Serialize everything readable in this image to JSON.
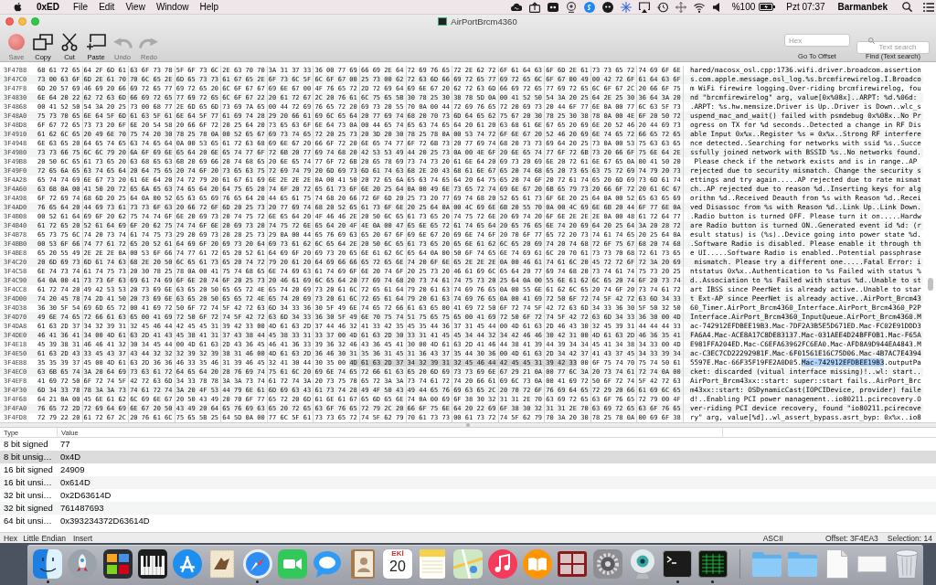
{
  "menu_bar": {
    "app_name": "0xED",
    "menus": [
      "File",
      "Edit",
      "View",
      "Window",
      "Help"
    ],
    "battery_text": "%100",
    "clock": "Pzt 07:37",
    "user": "Barmanbek"
  },
  "window": {
    "title": "AirPortBrcm4360"
  },
  "toolbar": {
    "tools": [
      {
        "kind": "save",
        "label": "Save",
        "disabled": true
      },
      {
        "kind": "copy",
        "label": "Copy",
        "disabled": false
      },
      {
        "kind": "cut",
        "label": "Cut",
        "disabled": false
      },
      {
        "kind": "paste",
        "label": "Paste",
        "disabled": false
      },
      {
        "kind": "undo",
        "label": "Undo",
        "disabled": true
      },
      {
        "kind": "redo",
        "label": "Redo",
        "disabled": true
      }
    ],
    "go_to_offset": {
      "placeholder": "Hex",
      "label": "Go To Offset"
    },
    "text_search": {
      "placeholder": "Text search",
      "label": "Find (Text search)"
    }
  },
  "hex_view": {
    "rows": [
      {
        "offset": "3F4788",
        "hex": [
          {
            "text": "68 61 72 65 64 2F 6D 61 63 6F 73 78 5F 6F 73 6C 2E 63 70 70 3A 31 37 33 36 00 77 69 66 69 2E 64 72 69 76 65 72 2E 62 72 6F 61 64 63 6F 6D 2E 61 73 73 65 72 74 69 6F 6E",
            "selected": false
          }
        ],
        "ascii": [
          {
            "text": "hared/macosx_osl.cpp:1736.wifi.driver.broadcom.assertion",
            "selected": false
          }
        ]
      },
      {
        "offset": "3F47C0",
        "hex": [
          {
            "text": "73 00 63 6F 6D 2E 61 70 70 6C 65 2E 6D 65 73 73 61 67 65 2E 6F 73 6C 5F 6C 6F 67 00 25 73 00 62 72 63 6D 66 69 72 65 77 69 72 65 6C 6F 67 00 49 00 42 72 6F 61 64 63 6F",
            "selected": false
          }
        ],
        "ascii": [
          {
            "text": "s.com.apple.message.osl_log.%s.brcmfirewirelog.I.Broadco",
            "selected": false
          }
        ]
      },
      {
        "offset": "3F47F8",
        "hex": [
          {
            "text": "6D 20 57 69 46 69 20 66 69 72 65 77 69 72 65 20 6C 6F 67 67 69 6E 67 00 4F 76 65 72 2D 72 69 64 69 6E 67 20 62 72 63 6D 66 69 72 65 77 69 72 65 6C 6F 67 2C 20 66 6F 75",
            "selected": false
          }
        ],
        "ascii": [
          {
            "text": "m WiFi firewire logging.Over-riding brcmfirewirelog, fou",
            "selected": false
          }
        ]
      },
      {
        "offset": "3F4830",
        "hex": [
          {
            "text": "6E 64 20 22 62 72 63 6D 66 69 72 65 77 69 72 65 6C 6F 67 22 20 61 72 67 2C 20 76 61 6C 75 65 5B 30 78 25 30 38 78 5D 0A 00 41 52 50 54 3A 20 25 64 2E 25 30 36 64 3A 20",
            "selected": false
          }
        ],
        "ascii": [
          {
            "text": "nd \"brcmfirewirelog\" arg, value[0x%08x]..ARPT: %d.%06d: ",
            "selected": false
          }
        ]
      },
      {
        "offset": "3F4868",
        "hex": [
          {
            "text": "00 41 52 50 54 3A 20 25 73 00 68 77 2E 6D 65 6D 73 69 7A 65 00 44 72 69 76 65 72 20 69 73 20 55 70 0A 00 44 72 69 76 65 72 20 69 73 20 44 6F 77 6E 0A 00 77 6C 63 5F 73",
            "selected": false
          }
        ],
        "ascii": [
          {
            "text": ".ARPT: %s.hw.memsize.Driver is Up..Driver is Down..wlc_s",
            "selected": false
          }
        ]
      },
      {
        "offset": "3F48A0",
        "hex": [
          {
            "text": "75 73 70 65 6E 64 5F 6D 61 63 5F 61 6E 64 5F 77 61 69 74 28 29 20 66 61 69 6C 65 64 20 77 69 74 68 20 70 73 6D 64 65 62 75 67 20 30 78 25 30 38 78 0A 00 4E 6F 20 50 72",
            "selected": false
          }
        ],
        "ascii": [
          {
            "text": "uspend_mac_and_wait() failed with psmdebug 0x%08x..No Pr",
            "selected": false
          }
        ]
      },
      {
        "offset": "3F48D8",
        "hex": [
          {
            "text": "6F 67 72 65 73 73 20 6F 6E 20 54 58 20 66 6F 72 20 25 64 20 73 65 63 6F 6E 64 73 0A 00 44 65 74 65 63 74 65 64 20 61 20 63 68 61 6E 67 65 20 69 6E 20 52 46 20 44 69 73",
            "selected": false
          }
        ],
        "ascii": [
          {
            "text": "ogress on TX for %d seconds..Detected a change in RF Dis",
            "selected": false
          }
        ]
      },
      {
        "offset": "3F4910",
        "hex": [
          {
            "text": "61 62 6C 65 20 49 6E 70 75 74 20 30 78 25 78 0A 00 52 65 67 69 73 74 65 72 20 25 73 20 3D 20 30 78 25 78 0A 00 53 74 72 6F 6E 67 20 52 46 20 69 6E 74 65 72 66 65 72 65",
            "selected": false
          }
        ],
        "ascii": [
          {
            "text": "able Input 0x%x..Register %s = 0x%x..Strong RF interfere",
            "selected": false
          }
        ]
      },
      {
        "offset": "3F4948",
        "hex": [
          {
            "text": "6E 63 65 20 64 65 74 65 63 74 65 64 0A 00 53 65 61 72 63 68 69 6E 67 20 66 6F 72 20 6E 65 74 77 6F 72 6B 73 20 77 69 74 68 20 73 73 69 64 20 25 73 0A 00 53 75 63 63 65",
            "selected": false
          }
        ],
        "ascii": [
          {
            "text": "nce detected..Searching for networks with ssid %s..Succe",
            "selected": false
          }
        ]
      },
      {
        "offset": "3F4980",
        "hex": [
          {
            "text": "73 73 66 75 6C 6C 79 20 6A 6F 69 6E 65 64 20 6E 65 74 77 6F 72 6B 20 77 69 74 68 20 42 53 53 49 44 20 25 73 0A 00 4E 6F 20 6E 65 74 77 6F 72 6B 73 20 66 6F 75 6E 64 2E",
            "selected": false
          }
        ],
        "ascii": [
          {
            "text": "ssfully joined network with BSSID %s..No networks found.",
            "selected": false
          }
        ]
      },
      {
        "offset": "3F49B8",
        "hex": [
          {
            "text": "20 50 6C 65 61 73 65 20 63 68 65 63 6B 20 69 66 20 74 68 65 20 6E 65 74 77 6F 72 6B 20 65 78 69 73 74 73 20 61 6E 64 20 69 73 20 69 6E 20 72 61 6E 67 65 0A 00 41 50 20",
            "selected": false
          }
        ],
        "ascii": [
          {
            "text": " Please check if the network exists and is in range..AP ",
            "selected": false
          }
        ]
      },
      {
        "offset": "3F49F0",
        "hex": [
          {
            "text": "72 65 6A 65 63 74 65 64 20 64 75 65 20 74 6F 20 73 65 63 75 72 69 74 79 20 6D 69 73 6D 61 74 63 68 2E 20 43 68 61 6E 67 65 20 74 68 65 20 73 65 63 75 72 69 74 79 20 73",
            "selected": false
          }
        ],
        "ascii": [
          {
            "text": "rejected due to security mismatch. Change the security s",
            "selected": false
          }
        ]
      },
      {
        "offset": "3F4A28",
        "hex": [
          {
            "text": "65 74 74 69 6E 67 73 20 61 6E 64 20 74 72 79 20 61 67 61 69 6E 2E 2E 2E 0A 00 41 50 20 72 65 6A 65 63 74 65 64 20 64 75 65 20 74 6F 20 72 61 74 65 20 6D 69 73 6D 61 74",
            "selected": false
          }
        ],
        "ascii": [
          {
            "text": "ettings and try again.....AP rejected due to rate mismat",
            "selected": false
          }
        ]
      },
      {
        "offset": "3F4A60",
        "hex": [
          {
            "text": "63 68 0A 00 41 50 20 72 65 6A 65 63 74 65 64 20 64 75 65 20 74 6F 20 72 65 61 73 6F 6E 20 25 64 0A 00 49 6E 73 65 72 74 69 6E 67 20 6B 65 79 73 20 66 6F 72 20 61 6C 67",
            "selected": false
          }
        ],
        "ascii": [
          {
            "text": "ch..AP rejected due to reason %d..Inserting keys for alg",
            "selected": false
          }
        ]
      },
      {
        "offset": "3F4A98",
        "hex": [
          {
            "text": "6F 72 69 74 68 6D 20 25 64 0A 00 52 65 63 65 69 76 65 64 20 44 65 61 75 74 68 20 66 72 6F 6D 20 25 73 20 77 69 74 68 20 52 65 61 73 6F 6E 20 25 64 0A 00 52 65 63 65 69",
            "selected": false
          }
        ],
        "ascii": [
          {
            "text": "orithm %d..Received Deauth from %s with Reason %d..Recei",
            "selected": false
          }
        ]
      },
      {
        "offset": "3F4AD0",
        "hex": [
          {
            "text": "76 65 64 20 44 69 73 61 73 73 6F 63 20 66 72 6F 6D 20 25 73 20 77 69 74 68 20 52 65 61 73 6F 6E 20 25 64 0A 00 4C 69 6E 6B 20 55 70 0A 00 4C 69 6E 6B 20 44 6F 77 6E 0A",
            "selected": false
          }
        ],
        "ascii": [
          {
            "text": "ved Disassoc from %s with Reason %d..Link Up..Link Down.",
            "selected": false
          }
        ]
      },
      {
        "offset": "3F4B08",
        "hex": [
          {
            "text": "00 52 61 64 69 6F 20 62 75 74 74 6F 6E 20 69 73 20 74 75 72 6E 65 64 20 4F 46 46 2E 20 50 6C 65 61 73 65 20 74 75 72 6E 20 69 74 20 6F 6E 2E 2E 2E 0A 00 48 61 72 64 77",
            "selected": false
          }
        ],
        "ascii": [
          {
            "text": ".Radio button is turned OFF. Please turn it on.....Hardw",
            "selected": false
          }
        ]
      },
      {
        "offset": "3F4B40",
        "hex": [
          {
            "text": "61 72 65 20 52 61 64 69 6F 20 62 75 74 74 6F 6E 20 69 73 20 74 75 72 6E 65 64 20 4F 4E 0A 00 47 65 6E 65 72 61 74 65 64 20 65 76 65 6E 74 20 69 64 20 25 64 3A 20 28 72",
            "selected": false
          }
        ],
        "ascii": [
          {
            "text": "are Radio button is turned ON..Generated event id %d: (r",
            "selected": false
          }
        ]
      },
      {
        "offset": "3F4B78",
        "hex": [
          {
            "text": "65 73 75 6C 74 20 73 74 61 74 75 73 29 20 69 73 20 28 25 73 29 0A 00 44 65 76 69 63 65 20 67 6F 69 6E 67 20 69 6E 74 6F 20 70 6F 77 65 72 20 73 74 61 74 65 20 25 64 0A",
            "selected": false
          }
        ],
        "ascii": [
          {
            "text": "esult status) is (%s)..Device going into power state %d.",
            "selected": false
          }
        ]
      },
      {
        "offset": "3F4BB0",
        "hex": [
          {
            "text": "00 53 6F 66 74 77 61 72 65 20 52 61 64 69 6F 20 69 73 20 64 69 73 61 62 6C 65 64 2E 20 50 6C 65 61 73 65 20 65 6E 61 62 6C 65 20 69 74 20 74 68 72 6F 75 67 68 20 74 68",
            "selected": false
          }
        ],
        "ascii": [
          {
            "text": ".Software Radio is disabled. Please enable it through th",
            "selected": false
          }
        ]
      },
      {
        "offset": "3F4BE8",
        "hex": [
          {
            "text": "65 20 55 49 2E 2E 2E 0A 00 53 6F 66 74 77 61 72 65 20 52 61 64 69 6F 20 69 73 20 65 6E 61 62 6C 65 64 0A 00 50 6F 74 65 6E 74 69 61 6C 20 70 61 73 73 70 68 72 61 73 65",
            "selected": false
          }
        ],
        "ascii": [
          {
            "text": "e UI.....Software Radio is enabled..Potential passphrase",
            "selected": false
          }
        ]
      },
      {
        "offset": "3F4C20",
        "hex": [
          {
            "text": "20 6D 69 73 6D 61 74 63 68 2E 20 50 6C 65 61 73 65 20 74 72 79 20 61 20 64 69 66 66 65 72 65 6E 74 20 6F 6E 65 2E 2E 2E 0A 00 46 61 74 61 6C 20 45 72 72 6F 72 3A 20 69",
            "selected": false
          }
        ],
        "ascii": [
          {
            "text": " mismatch. Please try a different one.....Fatal Error: i",
            "selected": false
          }
        ]
      },
      {
        "offset": "3F4C58",
        "hex": [
          {
            "text": "6E 74 73 74 61 74 75 73 20 30 78 25 78 0A 00 41 75 74 68 65 6E 74 69 63 61 74 69 6F 6E 20 74 6F 20 25 73 20 46 61 69 6C 65 64 20 77 69 74 68 20 73 74 61 74 75 73 20 25",
            "selected": false
          }
        ],
        "ascii": [
          {
            "text": "ntstatus 0x%x..Authentication to %s Failed with status %",
            "selected": false
          }
        ]
      },
      {
        "offset": "3F4C90",
        "hex": [
          {
            "text": "64 0A 00 41 73 73 6F 63 69 61 74 69 6F 6E 20 74 6F 20 25 73 20 46 61 69 6C 65 64 20 77 69 74 68 20 73 74 61 74 75 73 20 25 64 0A 00 55 6E 61 62 6C 65 20 74 6F 20 73 74",
            "selected": false
          }
        ],
        "ascii": [
          {
            "text": "d..Association to %s Failed with status %d..Unable to st",
            "selected": false
          }
        ]
      },
      {
        "offset": "3F4CC8",
        "hex": [
          {
            "text": "61 72 74 20 49 42 53 53 20 73 69 6E 63 65 20 50 65 65 72 4E 65 74 20 69 73 20 61 6C 72 65 61 64 79 20 61 63 74 69 76 65 0A 00 55 6E 61 62 6C 65 20 74 6F 20 73 74 61 72",
            "selected": false
          }
        ],
        "ascii": [
          {
            "text": "art IBSS since PeerNet is already active..Unable to star",
            "selected": false
          }
        ]
      },
      {
        "offset": "3F4D00",
        "hex": [
          {
            "text": "74 20 45 78 74 2D 41 50 20 73 69 6E 63 65 20 50 65 65 72 4E 65 74 20 69 73 20 61 6C 72 65 61 64 79 20 61 63 74 69 76 65 0A 00 41 69 72 50 6F 72 74 5F 42 72 63 6D 34 33",
            "selected": false
          }
        ],
        "ascii": [
          {
            "text": "t Ext-AP since PeerNet is already active..AirPort_Brcm43",
            "selected": false
          }
        ]
      },
      {
        "offset": "3F4D38",
        "hex": [
          {
            "text": "36 30 5F 54 69 6D 65 72 00 41 69 72 50 6F 72 74 5F 42 72 63 6D 34 33 36 30 5F 49 6E 74 65 72 66 61 63 65 00 41 69 72 50 6F 72 74 5F 42 72 63 6D 34 33 36 30 5F 50 32 50",
            "selected": false
          }
        ],
        "ascii": [
          {
            "text": "60_Timer.AirPort_Brcm4360_Interface.AirPort_Brcm4360_P2P",
            "selected": false
          }
        ]
      },
      {
        "offset": "3F4D70",
        "hex": [
          {
            "text": "49 6E 74 65 72 66 61 63 65 00 41 69 72 50 6F 72 74 5F 42 72 63 6D 34 33 36 30 5F 49 6E 70 75 74 51 75 65 75 65 00 41 69 72 50 6F 72 74 5F 42 72 63 6D 34 33 36 30 00 4D",
            "selected": false
          }
        ],
        "ascii": [
          {
            "text": "Interface.AirPort_Brcm4360_InputQueue.AirPort_Brcm4360.M",
            "selected": false
          }
        ]
      },
      {
        "offset": "3F4DA8",
        "hex": [
          {
            "text": "61 63 2D 37 34 32 39 31 32 45 46 44 42 45 45 31 39 42 33 00 4D 61 63 2D 37 44 46 32 41 33 42 35 45 35 44 36 37 31 45 44 00 4D 61 63 2D 46 43 30 32 45 39 31 44 44 44 33",
            "selected": false
          }
        ],
        "ascii": [
          {
            "text": "ac-742912EFDBEE19B3.Mac-7DF2A3B5E5D671ED.Mac-FC02E91DDD3",
            "selected": false
          }
        ]
      },
      {
        "offset": "3F4DE0",
        "hex": [
          {
            "text": "46 41 36 41 34 00 4D 61 63 2D 41 43 45 38 41 31 37 43 38 44 45 38 33 31 33 37 00 4D 61 63 2D 30 33 31 41 45 45 34 44 32 34 42 46 46 30 42 31 00 4D 61 63 2D 46 36 35 41",
            "selected": false
          }
        ],
        "ascii": [
          {
            "text": "FA6A4.Mac-ACE8A17C8DE83137.Mac-031AEE4D24BFF0B1.Mac-F65A",
            "selected": false
          }
        ]
      },
      {
        "offset": "3F4E18",
        "hex": [
          {
            "text": "45 39 38 31 46 46 41 32 30 34 45 44 00 4D 61 63 2D 43 36 45 46 41 36 33 39 36 32 46 43 36 45 41 30 00 4D 61 63 2D 41 46 44 38 41 39 44 39 34 34 45 41 34 38 34 33 00 4D",
            "selected": false
          }
        ],
        "ascii": [
          {
            "text": "E981FFA204ED.Mac-C6EFA63962FC6EA0.Mac-AFD8A9D944EA4843.M",
            "selected": false
          }
        ]
      },
      {
        "offset": "3F4E50",
        "hex": [
          {
            "text": "61 63 2D 43 33 45 43 37 43 44 32 32 32 39 32 39 38 31 46 00 4D 61 63 2D 36 46 30 31 35 36 31 45 31 36 43 37 35 44 30 36 00 4D 61 63 2D 34 42 37 41 43 37 45 34 33 39 34",
            "selected": false
          }
        ],
        "ascii": [
          {
            "text": "ac-C3EC7CD22292981F.Mac-6F01561E16C75D06.Mac-4B7AC7E4394",
            "selected": false
          }
        ]
      },
      {
        "offset": "3F4E88",
        "hex": [
          {
            "text": "35 35 39 37 45 00 4D 61 63 2D 36 36 46 33 35 46 31 39 46 45 32 41 30 44 30 35 00 ",
            "selected": false
          },
          {
            "text": "4D 61 63 2D 37 34 32 39 31 32 45 46 44 42 45 45 31 39 42 33",
            "selected": true
          },
          {
            "text": " 00 6F 75 74 70 75 74 50 61",
            "selected": false
          }
        ],
        "ascii": [
          {
            "text": "5597E.Mac-66F35F19FE2A0D05.",
            "selected": false
          },
          {
            "text": "Mac-742912EFDBEE19B3",
            "selected": true
          },
          {
            "text": ".outputPa",
            "selected": false
          }
        ]
      },
      {
        "offset": "3F4EC0",
        "hex": [
          {
            "text": "63 6B 65 74 3A 20 64 69 73 63 61 72 64 65 64 20 28 76 69 74 75 61 6C 20 69 6E 74 65 72 66 61 63 65 20 6D 69 73 73 69 6E 67 29 21 0A 00 77 6C 3A 20 73 74 61 72 74 0A 00",
            "selected": false
          }
        ],
        "ascii": [
          {
            "text": "cket: discarded (vitual interface missing)!..wl: start..",
            "selected": false
          }
        ]
      },
      {
        "offset": "3F4EF8",
        "hex": [
          {
            "text": "41 69 72 50 6F 72 74 5F 42 72 63 6D 34 33 78 78 3A 3A 73 74 61 72 74 3A 20 73 75 70 65 72 3A 3A 73 74 61 72 74 20 66 61 69 6C 73 0A 00 41 69 72 50 6F 72 74 5F 42 72 63",
            "selected": false
          }
        ],
        "ascii": [
          {
            "text": "AirPort_Brcm43xx::start: super::start fails..AirPort_Brc",
            "selected": false
          }
        ]
      },
      {
        "offset": "3F4F30",
        "hex": [
          {
            "text": "6D 34 33 78 78 3A 3A 73 74 61 72 74 3A 20 4F 53 44 79 6E 61 6D 69 63 43 61 73 74 28 49 4F 50 43 49 44 65 76 69 63 65 2C 20 70 72 6F 76 69 64 65 72 29 20 66 61 69 6C 65",
            "selected": false
          }
        ],
        "ascii": [
          {
            "text": "m43xx::start: OSDynamicCast(IOPCIDevice, provider) faile",
            "selected": false
          }
        ]
      },
      {
        "offset": "3F4F68",
        "hex": [
          {
            "text": "64 21 0A 00 45 6E 61 62 6C 69 6E 67 20 50 43 49 20 70 6F 77 65 72 20 6D 61 6E 61 67 65 6D 65 6E 74 0A 00 69 6F 38 30 32 31 31 2E 70 63 69 72 65 63 6F 76 65 72 79 00 4F",
            "selected": false
          }
        ],
        "ascii": [
          {
            "text": "d!..Enabling PCI power management..io80211.pcirecovery.O",
            "selected": false
          }
        ]
      },
      {
        "offset": "3F4FA0",
        "hex": [
          {
            "text": "76 65 72 2D 72 69 64 69 6E 67 20 50 43 49 20 64 65 76 69 63 65 20 72 65 63 6F 76 65 72 79 2C 20 66 6F 75 6E 64 20 22 69 6F 38 30 32 31 31 2E 70 63 69 72 65 63 6F 76 65",
            "selected": false
          }
        ],
        "ascii": [
          {
            "text": "ver-riding PCI device recovery, found \"io80211.pcirecove",
            "selected": false
          }
        ]
      },
      {
        "offset": "3F4FD8",
        "hex": [
          {
            "text": "72 79 22 20 61 72 67 2C 20 76 61 6C 75 65 5B 25 64 5D 0A 00 77 6C 5F 61 73 73 65 72 74 5F 62 79 70 61 73 73 00 61 73 72 74 5F 62 79 70 3A 20 30 78 25 78 0A 00 69 6F 38",
            "selected": false
          }
        ],
        "ascii": [
          {
            "text": "ry\" arg, value[%d]..wl_assert_bypass.asrt_byp: 0x%x..io8",
            "selected": false
          }
        ]
      }
    ]
  },
  "inspector": {
    "columns": [
      "Type",
      "Value"
    ],
    "rows": [
      {
        "type": "8 bit signed",
        "value": "77",
        "selected": false
      },
      {
        "type": "8 bit unsig…",
        "value": "0x4D",
        "selected": true
      },
      {
        "type": "16 bit signed",
        "value": "24909",
        "selected": false
      },
      {
        "type": "16 bit unsi…",
        "value": "0x614D",
        "selected": false
      },
      {
        "type": "32 bit unsi…",
        "value": "0x2D63614D",
        "selected": false
      },
      {
        "type": "32 bit signed",
        "value": "761487693",
        "selected": false
      },
      {
        "type": "64 bit unsi…",
        "value": "0x393234372D63614D",
        "selected": false
      }
    ]
  },
  "status_bar": {
    "mode": "Hex",
    "endianness": "Little Endian",
    "edit_mode": "Insert",
    "encoding": "ASCII",
    "offset": "Offset: 3F4EA3",
    "selection": "Selection: 14"
  },
  "dock": {
    "apps": [
      {
        "kind": "face",
        "running": true
      },
      {
        "kind": "rocket",
        "running": false
      },
      {
        "kind": "tiles",
        "running": false
      },
      {
        "kind": "piano",
        "running": false
      },
      {
        "kind": "brushes",
        "running": false
      },
      {
        "kind": "stamp",
        "running": false
      },
      {
        "kind": "compass",
        "running": true
      },
      {
        "kind": "camera",
        "running": false
      },
      {
        "kind": "bubble",
        "running": false
      },
      {
        "kind": "addressbook",
        "running": false
      },
      {
        "kind": "calendar",
        "running": false,
        "month": "EKİ",
        "day": "20"
      },
      {
        "kind": "notepad",
        "running": false
      },
      {
        "kind": "map",
        "running": false
      },
      {
        "kind": "music",
        "running": false
      },
      {
        "kind": "book",
        "running": false
      },
      {
        "kind": "photos",
        "running": false
      },
      {
        "kind": "gear",
        "running": false
      },
      {
        "kind": "webcam",
        "running": false
      },
      {
        "kind": "terminal",
        "running": true
      },
      {
        "kind": "monitor",
        "running": true
      }
    ],
    "stacks": [
      {
        "kind": "folder"
      },
      {
        "kind": "folder"
      },
      {
        "kind": "document"
      },
      {
        "kind": "card"
      },
      {
        "kind": "trash"
      }
    ]
  }
}
